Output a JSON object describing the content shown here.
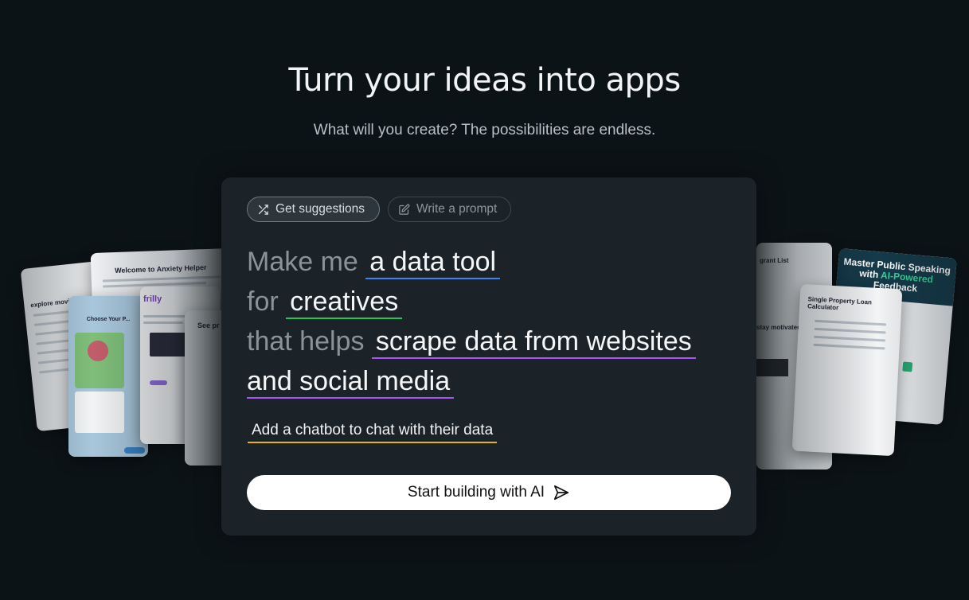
{
  "hero": {
    "title": "Turn your ideas into apps",
    "subtitle": "What will you create? The possibilities are endless."
  },
  "tabs": {
    "suggestions_label": "Get suggestions",
    "suggestions_icon": "shuffle-icon",
    "prompt_label": "Write a prompt",
    "prompt_icon": "edit-icon",
    "active": "Get suggestions"
  },
  "prompt": {
    "lead_1": "Make me",
    "choice_1": "a data tool",
    "lead_2": "for",
    "choice_2": "creatives",
    "lead_3": "that helps",
    "choice_3a": "scrape data from websites",
    "choice_3b": "and social media",
    "extra_feature": "Add a chatbot to chat with their data"
  },
  "accent_colors": {
    "choice_1": "#3b82f6",
    "choice_2": "#22c55e",
    "choice_3": "#a855f7",
    "extra_feature": "#eab308"
  },
  "cta": {
    "label": "Start building with AI",
    "icon": "send-icon"
  },
  "preview_cards": {
    "left": [
      {
        "title": "explore movies"
      },
      {
        "title": "Welcome to Anxiety Helper"
      },
      {
        "title": "Choose Your P..."
      },
      {
        "title": "frilly"
      },
      {
        "title": "See pr"
      }
    ],
    "right": [
      {
        "title": "Master Public Speaking with",
        "highlight": "AI-Powered",
        "title_end": "Feedback"
      },
      {
        "title": "grant List"
      },
      {
        "title": "stay motivated"
      },
      {
        "title": "Single Property Loan Calculator"
      }
    ]
  }
}
